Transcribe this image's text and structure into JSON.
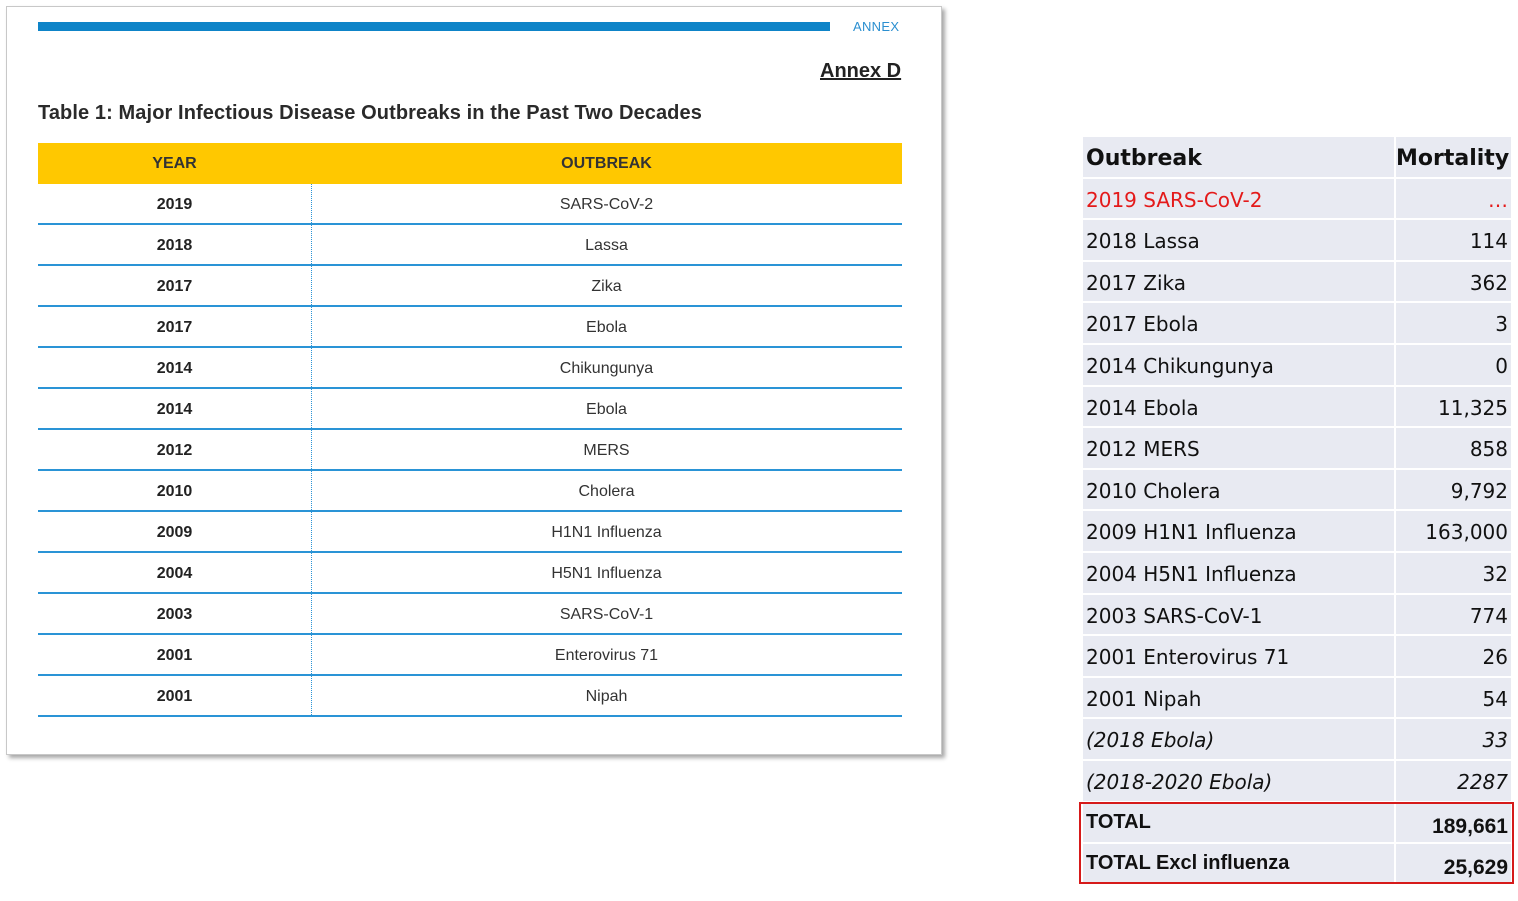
{
  "document": {
    "header_tag": "ANNEX",
    "annex_label": "Annex D",
    "title": "Table 1: Major Infectious Disease Outbreaks in the Past Two Decades",
    "columns": [
      "YEAR",
      "OUTBREAK"
    ],
    "rows": [
      [
        "2019",
        "SARS-CoV-2"
      ],
      [
        "2018",
        "Lassa"
      ],
      [
        "2017",
        "Zika"
      ],
      [
        "2017",
        "Ebola"
      ],
      [
        "2014",
        "Chikungunya"
      ],
      [
        "2014",
        "Ebola"
      ],
      [
        "2012",
        "MERS"
      ],
      [
        "2010",
        "Cholera"
      ],
      [
        "2009",
        "H1N1 Influenza"
      ],
      [
        "2004",
        "H5N1 Influenza"
      ],
      [
        "2003",
        "SARS-CoV-1"
      ],
      [
        "2001",
        "Enterovirus 71"
      ],
      [
        "2001",
        "Nipah"
      ]
    ],
    "colors": {
      "header_bar": "#0e84c8",
      "table_header": "#ffc800",
      "row_line": "#2a94d6"
    }
  },
  "mortality": {
    "columns": [
      "Outbreak",
      "Mortality"
    ],
    "rows": [
      [
        "2019 SARS-CoV-2",
        "…"
      ],
      [
        "2018 Lassa",
        "114"
      ],
      [
        "2017 Zika",
        "362"
      ],
      [
        "2017 Ebola",
        "3"
      ],
      [
        "2014 Chikungunya",
        "0"
      ],
      [
        "2014 Ebola",
        "11,325"
      ],
      [
        "2012 MERS",
        "858"
      ],
      [
        "2010 Cholera",
        "9,792"
      ],
      [
        "2009 H1N1 Influenza",
        "163,000"
      ],
      [
        "2004 H5N1 Influenza",
        "32"
      ],
      [
        "2003 SARS-CoV-1",
        "774"
      ],
      [
        "2001 Enterovirus 71",
        "26"
      ],
      [
        "2001 Nipah",
        "54"
      ]
    ],
    "italic_rows": [
      [
        "(2018 Ebola)",
        "33"
      ],
      [
        "(2018-2020 Ebola)",
        "2287"
      ]
    ],
    "totals": [
      [
        "TOTAL",
        "189,661"
      ],
      [
        "TOTAL  Excl influenza",
        "25,629"
      ]
    ],
    "colors": {
      "cell_bg": "#e8eaf2",
      "highlight_text": "#e41a1a",
      "total_box": "#d61a1a"
    }
  }
}
